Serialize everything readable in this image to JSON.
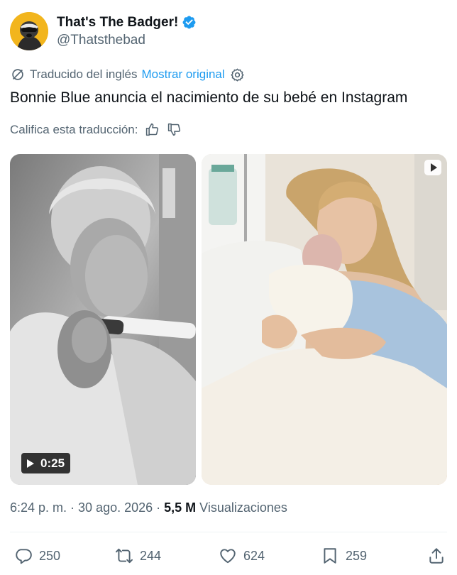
{
  "author": {
    "display_name": "That's The Badger!",
    "handle": "@Thatsthebad",
    "verified": true
  },
  "translation": {
    "label": "Traducido del inglés",
    "show_original": "Mostrar original"
  },
  "tweet": {
    "text": "Bonnie Blue anuncia el nacimiento de su bebé en Instagram"
  },
  "rating": {
    "label": "Califica esta traducción:"
  },
  "media": {
    "video_duration": "0:25"
  },
  "meta": {
    "timestamp": "6:24 p. m. · 30 ago. 2026 ·",
    "view_count": "5,5 M",
    "view_label": "Visualizaciones"
  },
  "actions": {
    "replies": "250",
    "reposts": "244",
    "likes": "624",
    "bookmarks": "259"
  },
  "colors": {
    "accent": "#1d9bf0",
    "text": "#0f1419",
    "secondary": "#536471"
  }
}
